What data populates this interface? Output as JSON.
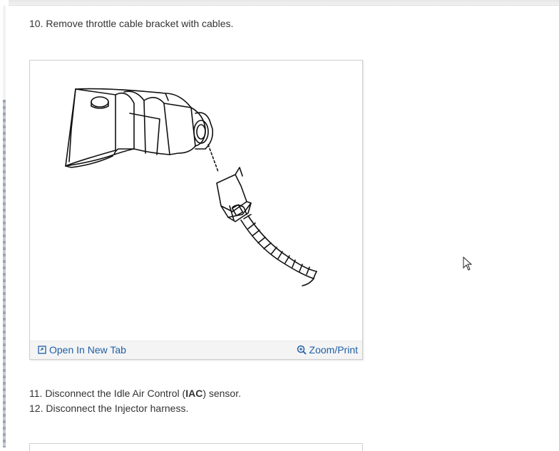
{
  "steps": {
    "step10": "10. Remove throttle cable bracket with cables.",
    "step11_prefix": "11. Disconnect the Idle Air Control (",
    "step11_bold": "IAC",
    "step11_suffix": ") sensor.",
    "step12": "12. Disconnect the Injector harness."
  },
  "figure": {
    "open_label": "Open In New Tab",
    "zoom_label": "Zoom/Print"
  },
  "colors": {
    "link": "#1f5fa6",
    "text": "#333333",
    "footer_bg": "#f4f4f4"
  },
  "icons": {
    "open": "open-in-new-tab-icon",
    "zoom": "zoom-icon",
    "cursor": "mouse-pointer-icon"
  }
}
